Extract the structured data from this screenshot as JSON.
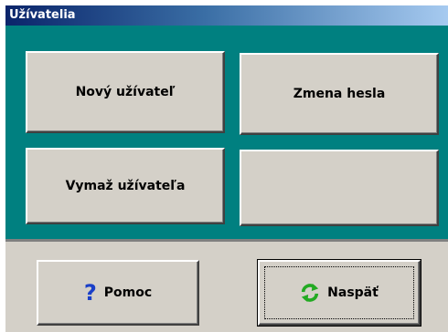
{
  "window": {
    "title": "Užívatelia"
  },
  "buttons": {
    "new_user": "Nový užívateľ",
    "change_password": "Zmena hesla",
    "delete_user": "Vymaž užívateľa",
    "empty": ""
  },
  "footer": {
    "help_label": "Pomoc",
    "help_icon": "question-mark-icon",
    "back_label": "Naspäť",
    "back_icon": "refresh-icon"
  },
  "colors": {
    "panel": "#008080",
    "face": "#d4d0c8",
    "title_start": "#0a246a",
    "help_icon": "#1a3fc8",
    "refresh_icon": "#22aa22"
  }
}
